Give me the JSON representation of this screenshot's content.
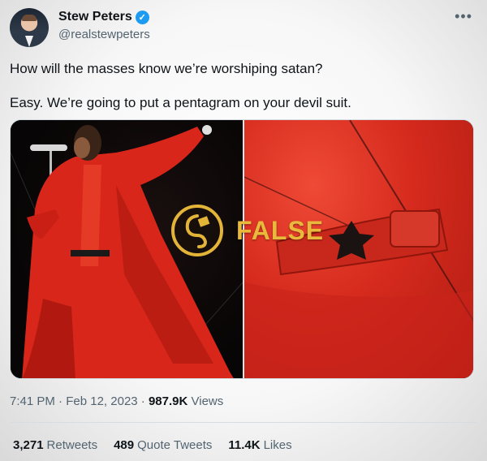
{
  "author": {
    "name": "Stew Peters",
    "handle": "@realstewpeters",
    "verified_icon": "verified-check-icon"
  },
  "more_icon": "more-horizontal-icon",
  "tweet": {
    "line1": "How will the masses know we’re worshiping satan?",
    "line2": "Easy. We’re going to put a pentagram on your devil suit."
  },
  "media": {
    "overlay_label": "FALSE",
    "overlay_color": "#e8b93b",
    "left_image": "performer-in-red-suit-photo",
    "right_image": "red-fabric-closeup-photo"
  },
  "meta": {
    "time": "7:41 PM",
    "date": "Feb 12, 2023",
    "views_count": "987.9K",
    "views_label": "Views"
  },
  "stats": {
    "retweets_count": "3,271",
    "retweets_label": "Retweets",
    "quotes_count": "489",
    "quotes_label": "Quote Tweets",
    "likes_count": "11.4K",
    "likes_label": "Likes"
  }
}
